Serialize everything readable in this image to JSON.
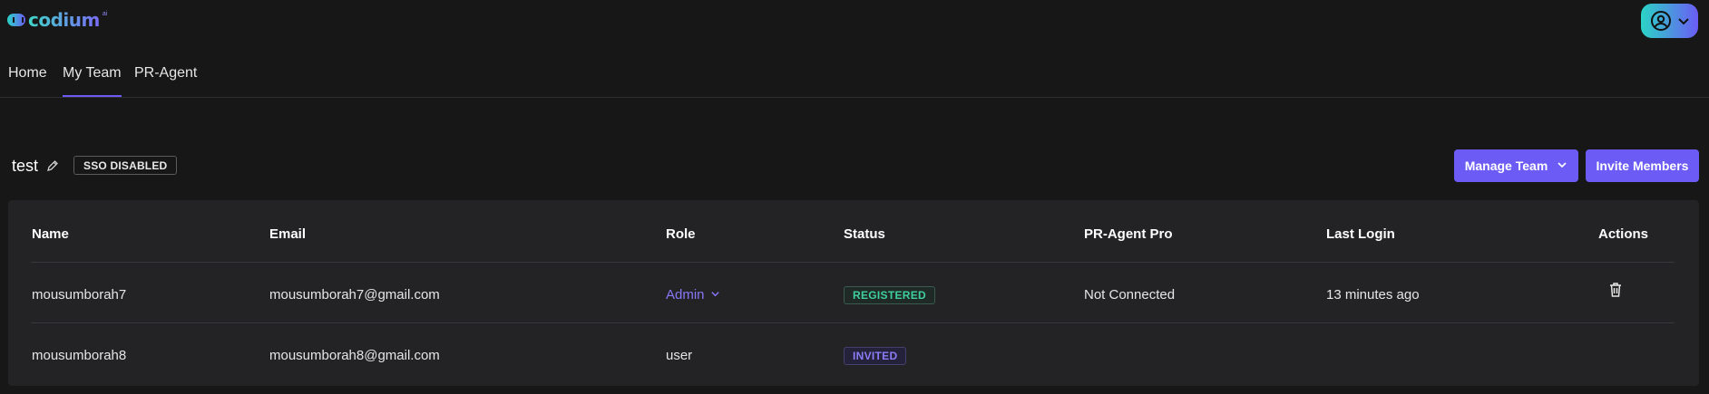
{
  "app": {
    "logo_text": "codium",
    "logo_sup": "ai"
  },
  "nav": {
    "tabs": [
      {
        "label": "Home",
        "active": false
      },
      {
        "label": "My Team",
        "active": true
      },
      {
        "label": "PR-Agent",
        "active": false
      }
    ]
  },
  "team": {
    "name": "test",
    "sso_badge": "SSO DISABLED",
    "manage_label": "Manage Team",
    "invite_label": "Invite Members"
  },
  "table": {
    "columns": [
      "Name",
      "Email",
      "Role",
      "Status",
      "PR-Agent Pro",
      "Last Login",
      "Actions"
    ],
    "rows": [
      {
        "name": "mousumborah7",
        "email": "mousumborah7@gmail.com",
        "role": "Admin",
        "status": "REGISTERED",
        "pr_agent_pro": "Not Connected",
        "last_login": "13 minutes ago"
      },
      {
        "name": "mousumborah8",
        "email": "mousumborah8@gmail.com",
        "role": "user",
        "status": "INVITED",
        "pr_agent_pro": "",
        "last_login": ""
      }
    ]
  },
  "colors": {
    "accent": "#6c5cf5",
    "background": "#171717",
    "card": "#232325",
    "registered": "#3fcf9f",
    "invited": "#8b7df7"
  },
  "icons": {
    "account": "user-circle-icon",
    "edit": "pencil-icon",
    "delete": "trash-icon",
    "dropdown": "chevron-down-icon"
  }
}
